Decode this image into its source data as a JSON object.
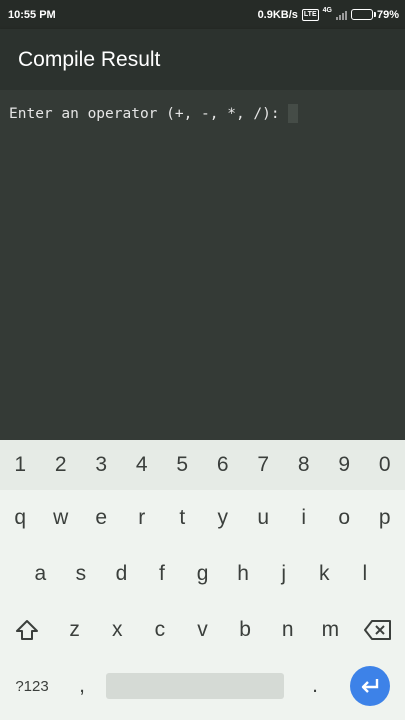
{
  "status_bar": {
    "time": "10:55 PM",
    "speed": "0.9KB/s",
    "lte": "VoLTE",
    "network": "4G",
    "battery_level": 0.79,
    "battery_text": "79%"
  },
  "app_bar": {
    "title": "Compile Result"
  },
  "console": {
    "prompt": "Enter an operator (+, -, *, /):"
  },
  "keyboard": {
    "numbers": [
      "1",
      "2",
      "3",
      "4",
      "5",
      "6",
      "7",
      "8",
      "9",
      "0"
    ],
    "row_q": [
      "q",
      "w",
      "e",
      "r",
      "t",
      "y",
      "u",
      "i",
      "o",
      "p"
    ],
    "row_a": [
      "a",
      "s",
      "d",
      "f",
      "g",
      "h",
      "j",
      "k",
      "l"
    ],
    "row_z": [
      "z",
      "x",
      "c",
      "v",
      "b",
      "n",
      "m"
    ],
    "symbols_label": "?123",
    "comma": ",",
    "period": "."
  }
}
